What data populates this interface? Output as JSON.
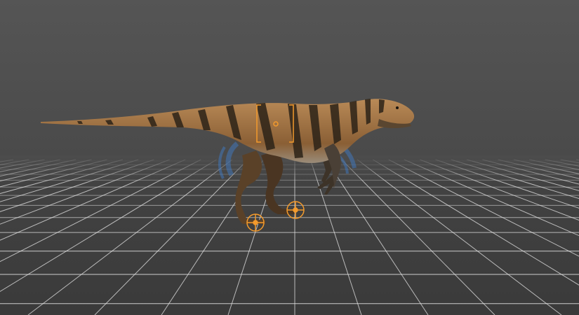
{
  "viewport": {
    "background_top": "#555555",
    "background_horizon": "#4a4a4a",
    "floor_color": "#3a3a3a",
    "grid_line_color": "#e6e6e6",
    "selection_color": "#f39a2c",
    "rotate_gizmo_color": "#3f7fd0"
  },
  "model": {
    "body_color_light": "#b98a57",
    "body_color_mid": "#8a5f35",
    "stripe_color": "#2c2318",
    "underside_color": "#9a8c7a"
  },
  "controls": {
    "body_selection_icon": "bracket-selection-icon",
    "foot_handle_icon": "crosshair-target-icon"
  }
}
